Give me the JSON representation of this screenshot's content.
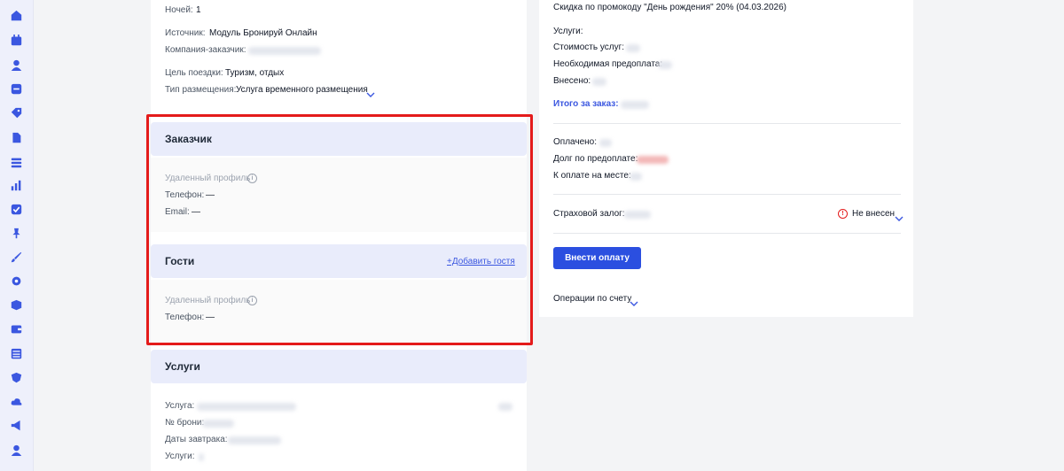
{
  "sidebar": {
    "icons": [
      "home-icon",
      "calendar-icon",
      "user-icon",
      "percent-icon",
      "tag-icon",
      "document-icon",
      "layers-icon",
      "bar-chart-icon",
      "check-square-icon",
      "pin-icon",
      "brush-icon",
      "gear-icon",
      "box-icon",
      "wallet-icon",
      "table-icon",
      "shield-icon",
      "cloud-icon",
      "megaphone-icon",
      "profile-icon"
    ]
  },
  "booking": {
    "nights_label": "Ночей:",
    "nights_value": "1",
    "source_label": "Источник:",
    "source_value": "Модуль Бронируй Онлайн",
    "company_label": "Компания-заказчик:",
    "trip_purpose_label": "Цель поездки:",
    "trip_purpose_value": "Туризм, отдых",
    "accommodation_label": "Тип размещения:",
    "accommodation_value": "Услуга временного размещения"
  },
  "customer": {
    "title": "Заказчик",
    "deleted_profile": "Удаленный профиль",
    "phone_label": "Телефон:",
    "phone_value": "—",
    "email_label": "Email:",
    "email_value": "—"
  },
  "guests": {
    "title": "Гости",
    "add_guest": "+Добавить гостя",
    "deleted_profile": "Удаленный профиль",
    "phone_label": "Телефон:",
    "phone_value": "—"
  },
  "services": {
    "title": "Услуги",
    "service_label": "Услуга:",
    "booking_no_label": "№ брони:",
    "breakfast_dates_label": "Даты завтрака:",
    "services_label": "Услуги:"
  },
  "payment": {
    "promo": "Скидка по промокоду \"День рождения\" 20% (04.03.2026)",
    "services_heading": "Услуги:",
    "cost_label": "Стоимость услуг:",
    "prepay_label": "Необходимая предоплата:",
    "deposited_label": "Внесено:",
    "total_label": "Итого за заказ:",
    "paid_label": "Оплачено:",
    "debt_label": "Долг по предоплате:",
    "onsite_label": "К оплате на месте:",
    "insurance_label": "Страховой залог:",
    "insurance_status": "Не внесен",
    "pay_button": "Внести оплату",
    "operations_label": "Операции по счету"
  },
  "colors": {
    "accent": "#2b4fe0",
    "highlight": "#e41b1b",
    "section_bg": "#e9ecfb"
  }
}
